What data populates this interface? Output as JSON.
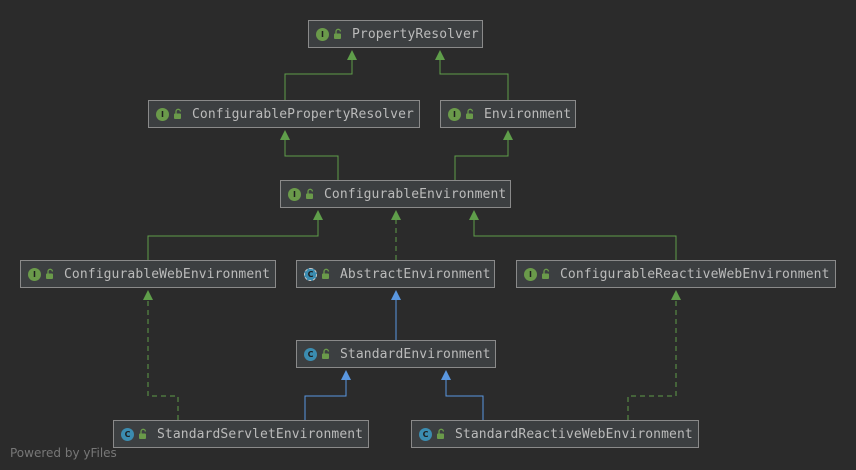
{
  "nodes": [
    {
      "id": "property-resolver",
      "label": "PropertyResolver",
      "kind": "interface",
      "kind_letter": "I"
    },
    {
      "id": "configurable-property-resolver",
      "label": "ConfigurablePropertyResolver",
      "kind": "interface",
      "kind_letter": "I"
    },
    {
      "id": "environment",
      "label": "Environment",
      "kind": "interface",
      "kind_letter": "I"
    },
    {
      "id": "configurable-environment",
      "label": "ConfigurableEnvironment",
      "kind": "interface",
      "kind_letter": "I"
    },
    {
      "id": "configurable-web-environment",
      "label": "ConfigurableWebEnvironment",
      "kind": "interface",
      "kind_letter": "I"
    },
    {
      "id": "abstract-environment",
      "label": "AbstractEnvironment",
      "kind": "abstract",
      "kind_letter": "C"
    },
    {
      "id": "configurable-reactive-web-environment",
      "label": "ConfigurableReactiveWebEnvironment",
      "kind": "interface",
      "kind_letter": "I"
    },
    {
      "id": "standard-environment",
      "label": "StandardEnvironment",
      "kind": "class",
      "kind_letter": "C"
    },
    {
      "id": "standard-servlet-environment",
      "label": "StandardServletEnvironment",
      "kind": "class",
      "kind_letter": "C"
    },
    {
      "id": "standard-reactive-web-environment",
      "label": "StandardReactiveWebEnvironment",
      "kind": "class",
      "kind_letter": "C"
    }
  ],
  "edges": [
    {
      "from": "configurable-property-resolver",
      "to": "property-resolver",
      "type": "extends-interface"
    },
    {
      "from": "environment",
      "to": "property-resolver",
      "type": "extends-interface"
    },
    {
      "from": "configurable-environment",
      "to": "configurable-property-resolver",
      "type": "extends-interface"
    },
    {
      "from": "configurable-environment",
      "to": "environment",
      "type": "extends-interface"
    },
    {
      "from": "configurable-web-environment",
      "to": "configurable-environment",
      "type": "extends-interface"
    },
    {
      "from": "abstract-environment",
      "to": "configurable-environment",
      "type": "implements"
    },
    {
      "from": "configurable-reactive-web-environment",
      "to": "configurable-environment",
      "type": "extends-interface"
    },
    {
      "from": "standard-environment",
      "to": "abstract-environment",
      "type": "extends-class"
    },
    {
      "from": "standard-servlet-environment",
      "to": "standard-environment",
      "type": "extends-class"
    },
    {
      "from": "standard-servlet-environment",
      "to": "configurable-web-environment",
      "type": "implements"
    },
    {
      "from": "standard-reactive-web-environment",
      "to": "standard-environment",
      "type": "extends-class"
    },
    {
      "from": "standard-reactive-web-environment",
      "to": "configurable-reactive-web-environment",
      "type": "implements"
    }
  ],
  "colors": {
    "background": "#2b2b2b",
    "node_fill": "#3c3f41",
    "node_border": "#8a8a8a",
    "text": "#bbbbbb",
    "interface_edge": "#5f9e4a",
    "class_edge": "#5a97e0",
    "interface_badge": "#6a9a4a",
    "class_badge": "#3b8cb0"
  },
  "footer": {
    "text": "Powered by yFiles"
  }
}
